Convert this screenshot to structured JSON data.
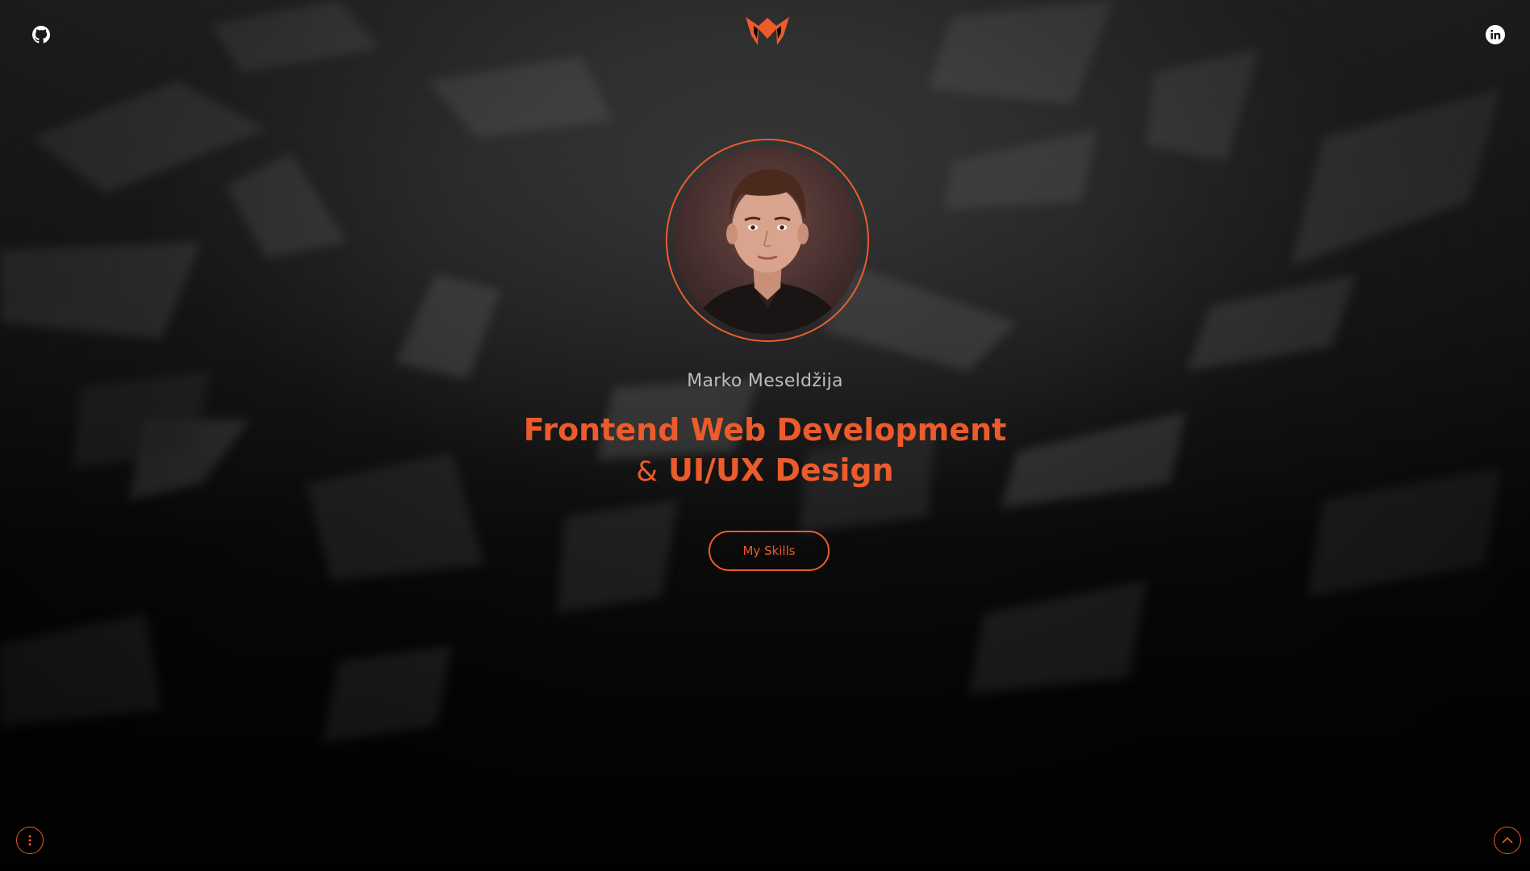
{
  "profile": {
    "name": "Marko Meseldžija",
    "headline_line1": "Frontend Web Development",
    "headline_amp": "&",
    "headline_line2": "UI/UX Design"
  },
  "actions": {
    "skills_label": "My Skills"
  },
  "icons": {
    "top_left": "github-icon",
    "top_center": "logo-m",
    "top_right": "linkedin-icon",
    "bottom_left": "more-vertical-icon",
    "bottom_right": "chevron-up-icon"
  },
  "colors": {
    "accent": "#ec5b2c",
    "name_text": "#bdbdbd",
    "background": "#050505"
  }
}
